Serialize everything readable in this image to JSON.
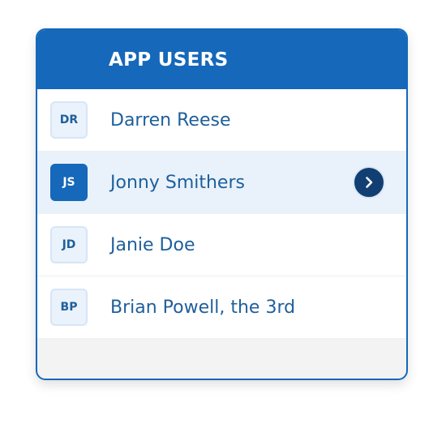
{
  "header": {
    "title": "APP USERS"
  },
  "users": [
    {
      "initials": "DR",
      "name": "Darren Reese"
    },
    {
      "initials": "JS",
      "name": "Jonny Smithers"
    },
    {
      "initials": "JD",
      "name": "Janie Doe"
    },
    {
      "initials": "BP",
      "name": "Brian Powell, the 3rd"
    }
  ],
  "selected_user_index": 1,
  "colors": {
    "accent": "#1568ba",
    "selected_row": "#e9f2fb",
    "name_text": "#1f5f9c",
    "go_button": "#123f72"
  },
  "icons": {
    "go_button": "chevron-right-icon"
  }
}
